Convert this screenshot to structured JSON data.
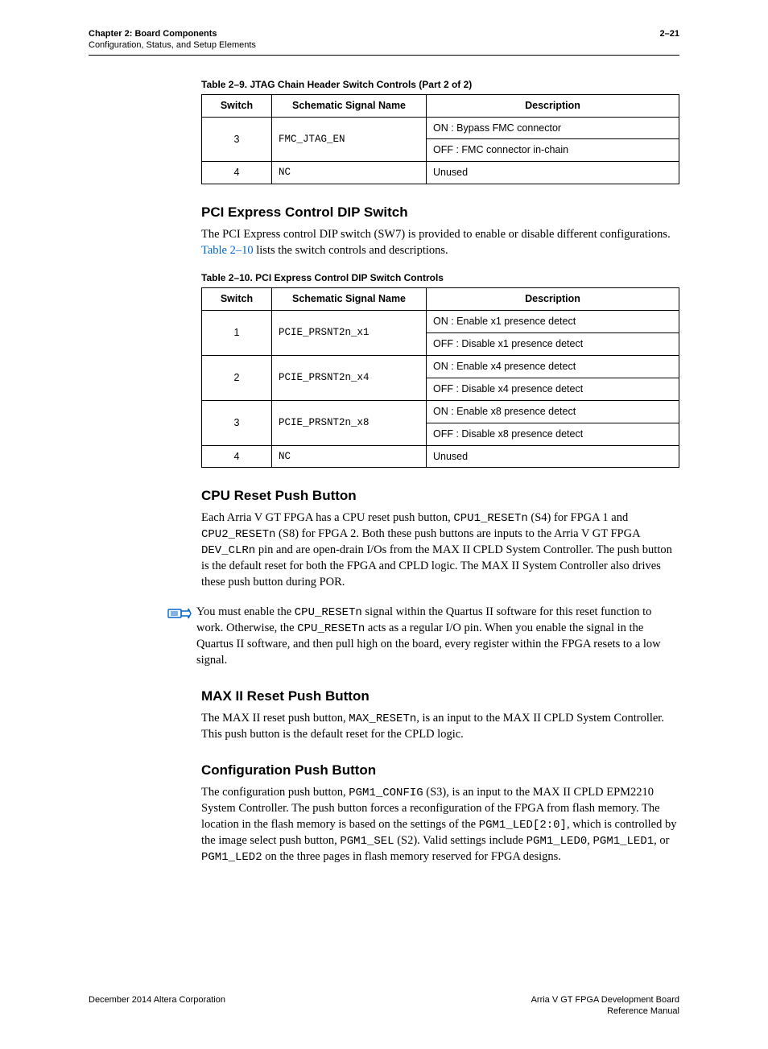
{
  "header": {
    "chapter": "Chapter 2: Board Components",
    "subtitle": "Configuration, Status, and Setup Elements",
    "page": "2–21"
  },
  "table29": {
    "caption": "Table 2–9. JTAG Chain Header Switch Controls  (Part 2 of 2)",
    "h1": "Switch",
    "h2": "Schematic Signal Name",
    "h3": "Description",
    "r1_s": "3",
    "r1_sig": "FMC_JTAG_EN",
    "r1_d1": "ON : Bypass FMC connector",
    "r1_d2": "OFF : FMC connector in-chain",
    "r2_s": "4",
    "r2_sig": "NC",
    "r2_d": "Unused"
  },
  "pci": {
    "title": "PCI Express Control DIP Switch",
    "p1a": "The PCI Express control DIP switch (SW7) is provided to enable or disable different configurations. ",
    "link": "Table 2–10",
    "p1b": " lists the switch controls and descriptions."
  },
  "table210": {
    "caption": "Table 2–10. PCI Express Control DIP Switch Controls",
    "h1": "Switch",
    "h2": "Schematic Signal Name",
    "h3": "Description",
    "r1_s": "1",
    "r1_sig": "PCIE_PRSNT2n_x1",
    "r1_d1": "ON : Enable x1 presence detect",
    "r1_d2": "OFF : Disable x1 presence detect",
    "r2_s": "2",
    "r2_sig": "PCIE_PRSNT2n_x4",
    "r2_d1": "ON : Enable x4 presence detect",
    "r2_d2": "OFF : Disable x4 presence detect",
    "r3_s": "3",
    "r3_sig": "PCIE_PRSNT2n_x8",
    "r3_d1": "ON : Enable x8 presence detect",
    "r3_d2": "OFF : Disable x8 presence detect",
    "r4_s": "4",
    "r4_sig": "NC",
    "r4_d": "Unused"
  },
  "cpu": {
    "title": "CPU Reset Push Button",
    "p_a": "Each Arria V GT FPGA has a CPU reset push button, ",
    "m1": "CPU1_RESETn",
    "p_b": " (S4) for FPGA 1 and ",
    "m2": "CPU2_RESETn",
    "p_c": " (S8) for FPGA 2. Both these push buttons are inputs to the Arria V GT FPGA ",
    "m3": "DEV_CLRn",
    "p_d": " pin and are open-drain I/Os from the MAX II CPLD System Controller. The push button is the default reset for both the FPGA and CPLD logic. The MAX II System Controller also drives these push button during POR."
  },
  "note": {
    "a": "You must enable the ",
    "m1": "CPU_RESETn",
    "b": " signal within the Quartus II software for this reset function to work. Otherwise, the ",
    "m2": "CPU_RESETn",
    "c": " acts as a regular I/O pin. When you enable the signal in the Quartus II software, and then pull high on the board, every register within the FPGA resets to a low signal."
  },
  "max2": {
    "title": "MAX II Reset Push Button",
    "a": "The MAX II reset push button, ",
    "m1": "MAX_RESETn",
    "b": ", is an input to the MAX II CPLD System Controller. This push button is the default reset for the CPLD logic."
  },
  "config": {
    "title": "Configuration Push Button",
    "a": "The configuration push button, ",
    "m1": "PGM1_CONFIG",
    "b": " (S3), is an input to the MAX II CPLD EPM2210 System Controller. The push button forces a reconfiguration of the FPGA from flash memory. The location in the flash memory is based on the settings of the ",
    "m2": "PGM1_LED[2:0]",
    "c": ", which is controlled by the image select push button, ",
    "m3": "PGM1_SEL",
    "d": " (S2). Valid settings include ",
    "m4": "PGM1_LED0",
    "e": ", ",
    "m5": "PGM1_LED1",
    "f": ", or ",
    "m6": "PGM1_LED2",
    "g": " on the three pages in flash memory reserved for FPGA designs."
  },
  "footer": {
    "left": "December 2014   Altera Corporation",
    "right1": "Arria V GT FPGA Development Board",
    "right2": "Reference Manual"
  }
}
